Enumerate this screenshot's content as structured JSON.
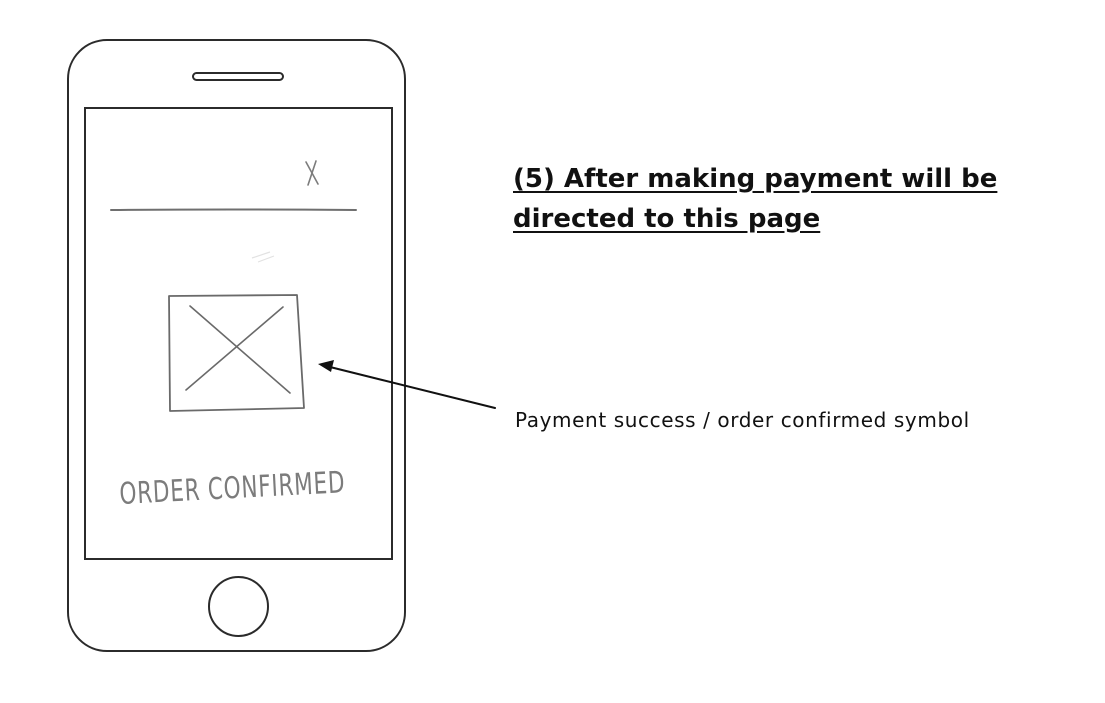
{
  "annotation": {
    "heading": "(5) After making payment will be directed to this page",
    "symbol_note": "Payment success / order confirmed symbol"
  },
  "screen": {
    "close_mark": "X",
    "confirmation_label": "ORDER CONFIRMED"
  },
  "icons": {
    "close": "close-icon",
    "image_placeholder": "image-placeholder-icon",
    "pointer": "arrow-icon"
  },
  "colors": {
    "outline": "#2b2b2b",
    "sketch": "#7c7c7c",
    "text": "#111111"
  }
}
